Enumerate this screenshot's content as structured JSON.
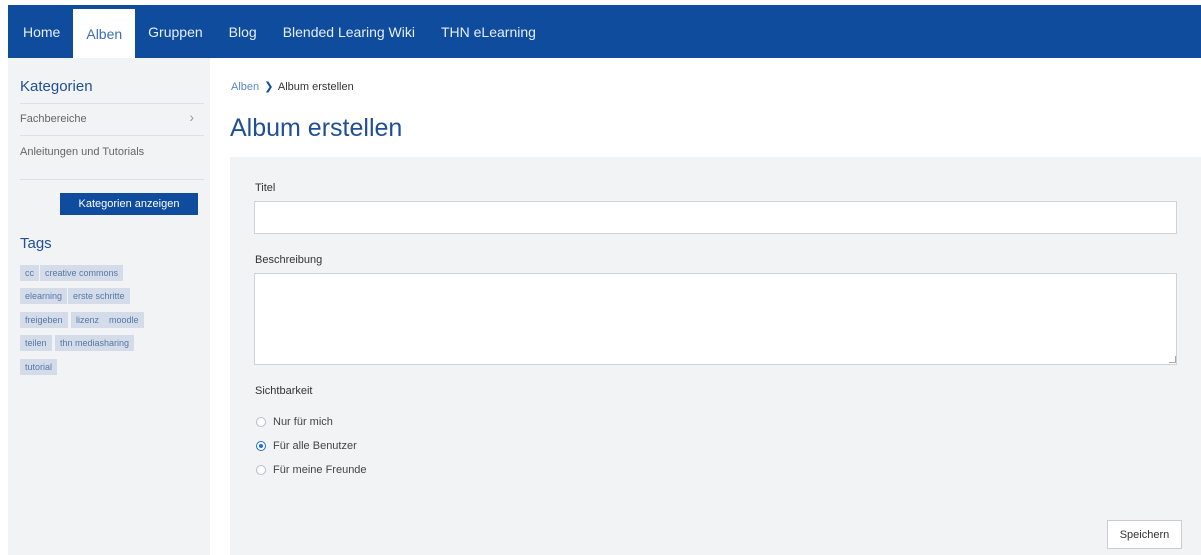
{
  "nav": {
    "items": [
      "Home",
      "Alben",
      "Gruppen",
      "Blog",
      "Blended Learing Wiki",
      "THN eLearning"
    ],
    "active": "Alben"
  },
  "sidebar": {
    "categories_title": "Kategorien",
    "categories": [
      {
        "label": "Fachbereiche",
        "has_children": true
      },
      {
        "label": "Anleitungen und Tutorials",
        "has_children": false
      }
    ],
    "show_categories_button": "Kategorien anzeigen",
    "tags_title": "Tags",
    "tags": [
      "cc",
      "creative commons",
      "elearning",
      "erste schritte",
      "freigeben",
      "lizenz",
      "moodle",
      "teilen",
      "thn mediasharing",
      "tutorial"
    ]
  },
  "breadcrumb": {
    "parent": "Alben",
    "separator": "❯",
    "current": "Album erstellen"
  },
  "page_title": "Album erstellen",
  "form": {
    "title_label": "Titel",
    "title_value": "",
    "description_label": "Beschreibung",
    "description_value": "",
    "visibility_label": "Sichtbarkeit",
    "visibility_options": [
      {
        "label": "Nur für mich",
        "checked": false
      },
      {
        "label": "Für alle Benutzer",
        "checked": true
      },
      {
        "label": "Für meine Freunde",
        "checked": false
      }
    ],
    "save_label": "Speichern"
  },
  "colors": {
    "brand": "#0f4c9e",
    "title": "#1f4f95",
    "panel": "#f2f3f5",
    "tag_bg": "#d4dcea"
  }
}
